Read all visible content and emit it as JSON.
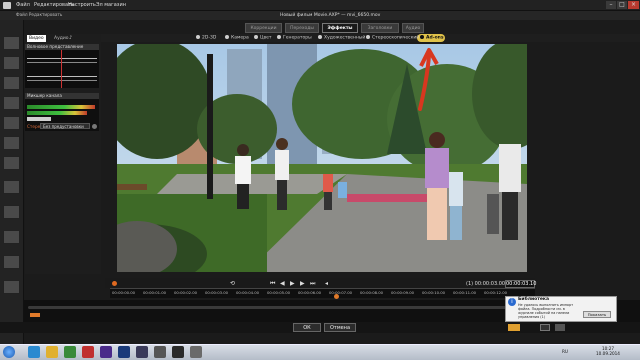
{
  "menu": {
    "items": [
      "Файл",
      "Редактировать",
      "Настроить",
      "Эл магазин"
    ]
  },
  "subtitle": {
    "left": "Файл   Редактировать"
  },
  "project": {
    "title": "Новый фильм Movie.AXP* — mvi_6650.mov"
  },
  "mode_tabs": [
    {
      "label": "Коррекции",
      "active": false
    },
    {
      "label": "Переходы",
      "active": false
    },
    {
      "label": "Эффекты",
      "active": true
    },
    {
      "label": "Заголовки",
      "active": false
    },
    {
      "label": "Аудио",
      "active": false
    }
  ],
  "categories": [
    "2D-3D",
    "Камера",
    "Цвет",
    "Генераторы",
    "Художественный",
    "Стереоскопический",
    "Ad-ons"
  ],
  "left_panel": {
    "tabs": [
      "Видео",
      "Аудио"
    ],
    "wave_title": "Волновое представление",
    "meter_title": "Микшер канала",
    "preset_label": "Стерео",
    "preset_value": "Без предустановки"
  },
  "transport": {
    "timecode": "(1) 00:00:03.00",
    "current": "00:00:03.10",
    "left_code": "00:00:00.00",
    "ruler": [
      "00:00:00.00",
      "00:00:01.00",
      "00:00:02.00",
      "00:00:03.00",
      "00:00:04.00",
      "00:00:05.00",
      "00:00:06.00",
      "00:00:07.00",
      "00:00:08.00",
      "00:00:09.00",
      "00:00:10.00",
      "00:00:11.00",
      "00:00:12.00"
    ]
  },
  "notification": {
    "title": "Библиотека",
    "text": "Не удалось выполнить импорт файла. Подробности см. в журнале событий на панели управления (1)",
    "button": "Показать"
  },
  "footer": {
    "ok": "ОК",
    "cancel": "Отмена"
  },
  "taskbar": {
    "lang": "RU",
    "time": "10:27",
    "date": "10.09.2014"
  },
  "colors": {
    "accent": "#e0c24a",
    "orange": "#e07a2a",
    "arrow": "#d8371f"
  }
}
